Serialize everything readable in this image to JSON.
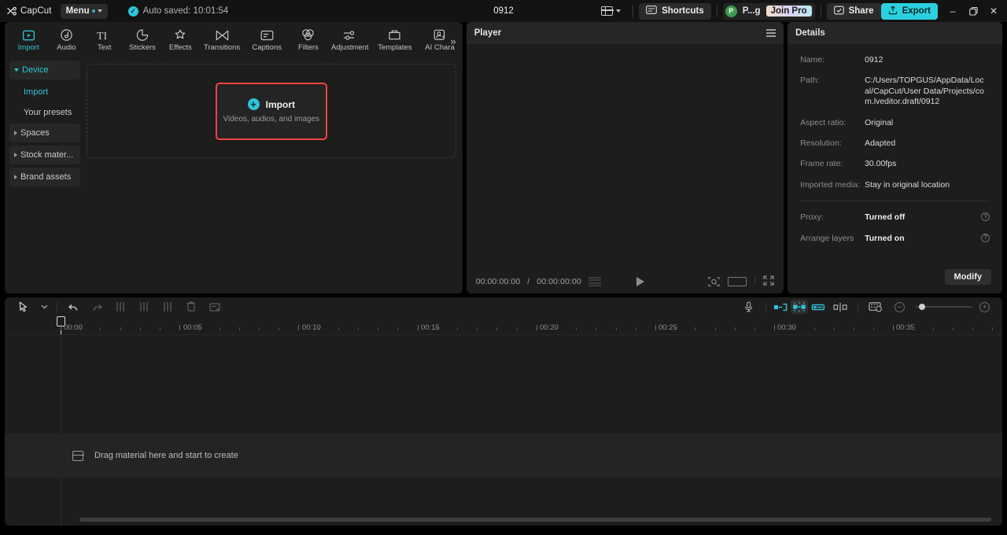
{
  "topbar": {
    "brand": "CapCut",
    "menu_label": "Menu",
    "autosave_text": "Auto saved: 10:01:54",
    "project_title": "0912",
    "layout_icon": "layout-icon",
    "shortcuts_label": "Shortcuts",
    "account_initial": "P",
    "account_name": "P...g",
    "join_pro_label": "Join Pro",
    "share_label": "Share",
    "export_label": "Export",
    "minimize_glyph": "–",
    "maximize_glyph": "❐",
    "close_glyph": "✕"
  },
  "tabs": [
    {
      "label": "Import",
      "icon": "import-icon",
      "active": true
    },
    {
      "label": "Audio",
      "icon": "audio-note-icon",
      "active": false
    },
    {
      "label": "Text",
      "icon": "text-ti-icon",
      "active": false
    },
    {
      "label": "Stickers",
      "icon": "sticker-icon",
      "active": false
    },
    {
      "label": "Effects",
      "icon": "effects-sparkle-icon",
      "active": false
    },
    {
      "label": "Transitions",
      "icon": "transitions-bowtie-icon",
      "active": false
    },
    {
      "label": "Captions",
      "icon": "captions-icon",
      "active": false
    },
    {
      "label": "Filters",
      "icon": "filters-circles-icon",
      "active": false
    },
    {
      "label": "Adjustment",
      "icon": "adjustment-sliders-icon",
      "active": false
    },
    {
      "label": "Templates",
      "icon": "templates-folder-icon",
      "active": false
    },
    {
      "label": "AI Chara",
      "icon": "ai-character-icon",
      "active": false
    }
  ],
  "sidebar": {
    "items": [
      {
        "label": "Device",
        "type": "group",
        "expanded": true,
        "active": true
      },
      {
        "label": "Import",
        "type": "sub",
        "active": true
      },
      {
        "label": "Your presets",
        "type": "sub",
        "active": false
      },
      {
        "label": "Spaces",
        "type": "group",
        "expanded": false,
        "active": false
      },
      {
        "label": "Stock mater...",
        "type": "group",
        "expanded": false,
        "active": false
      },
      {
        "label": "Brand assets",
        "type": "group",
        "expanded": false,
        "active": false
      }
    ]
  },
  "import_card": {
    "title": "Import",
    "subtitle": "Videos, audios, and images",
    "plus_icon": "plus-circle-icon",
    "highlight_color": "#f2453d"
  },
  "player": {
    "title": "Player",
    "menu_icon": "hamburger-icon",
    "current_time": "00:00:00:00",
    "total_time": "00:00:00:00",
    "time_separator": "/",
    "play_icon": "play-icon",
    "quality_icon": "lines-icon",
    "crop_icon": "crop-focus-icon",
    "ratio_icon": "aspect-ratio-icon",
    "fullscreen_icon": "fullscreen-icon"
  },
  "details": {
    "title": "Details",
    "rows": [
      {
        "key": "Name:",
        "value": "0912"
      },
      {
        "key": "Path:",
        "value": "C:/Users/TOPGUS/AppData/Local/CapCut/User Data/Projects/com.lveditor.draft/0912"
      },
      {
        "key": "Aspect ratio:",
        "value": "Original"
      },
      {
        "key": "Resolution:",
        "value": "Adapted"
      },
      {
        "key": "Frame rate:",
        "value": "30.00fps"
      },
      {
        "key": "Imported media:",
        "value": "Stay in original location"
      }
    ],
    "toggles": [
      {
        "key": "Proxy:",
        "value": "Turned off",
        "help_icon": "help-circle-icon"
      },
      {
        "key": "Arrange layers",
        "value": "Turned on",
        "help_icon": "help-circle-icon"
      }
    ],
    "modify_label": "Modify"
  },
  "timeline": {
    "tools": [
      {
        "name": "select-cursor-icon",
        "enabled": true
      },
      {
        "name": "cursor-dropdown-icon",
        "enabled": true
      },
      {
        "name": "undo-icon",
        "enabled": true
      },
      {
        "name": "redo-icon",
        "enabled": false
      },
      {
        "name": "split-icon",
        "enabled": false
      },
      {
        "name": "trim-left-icon",
        "enabled": false
      },
      {
        "name": "trim-right-icon",
        "enabled": false
      },
      {
        "name": "delete-icon",
        "enabled": false
      },
      {
        "name": "crop-clip-icon",
        "enabled": false
      }
    ],
    "right_tools": [
      {
        "name": "microphone-icon",
        "selected": false
      },
      {
        "name": "auto-cut-in-icon",
        "selected": false
      },
      {
        "name": "auto-cut-all-icon",
        "selected": true
      },
      {
        "name": "auto-cut-out-icon",
        "selected": false
      },
      {
        "name": "keyframe-mark-icon",
        "selected": false
      },
      {
        "name": "preview-thumbnail-icon",
        "selected": false
      }
    ],
    "zoom_out_icon": "zoom-out-icon",
    "zoom_in_icon": "zoom-in-icon",
    "ruler_labels": [
      "00:00",
      "00:05",
      "00:10",
      "00:15",
      "00:20",
      "00:25",
      "00:30",
      "00:35"
    ],
    "drop_hint": "Drag material here and start to create",
    "drop_icon": "media-track-icon"
  }
}
